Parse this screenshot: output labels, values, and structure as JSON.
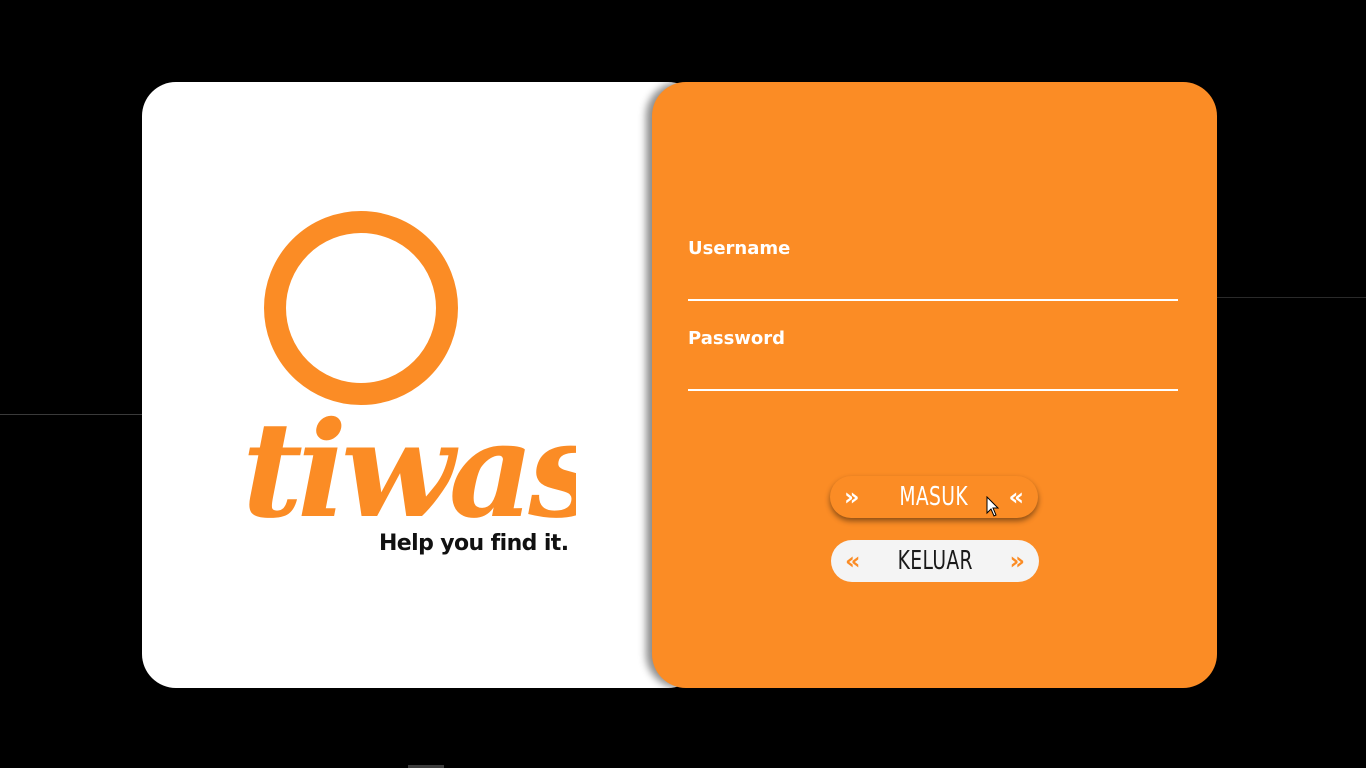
{
  "colors": {
    "accent": "#fb8c25",
    "background": "#000000",
    "card_left": "#ffffff",
    "text_light": "#ffffff",
    "text_dark": "#1a1a1a"
  },
  "brand": {
    "name": "tiwas",
    "tagline": "Help you find it."
  },
  "login": {
    "username_label": "Username",
    "username_value": "",
    "password_label": "Password",
    "password_value": "",
    "submit_label": "MASUK",
    "exit_label": "KELUAR",
    "submit_left_icon": "double-chevron-right-icon",
    "submit_right_icon": "double-chevron-left-icon",
    "exit_left_icon": "double-chevron-left-icon",
    "exit_right_icon": "double-chevron-right-icon"
  },
  "glyphs": {
    "right": "»",
    "left": "«"
  }
}
